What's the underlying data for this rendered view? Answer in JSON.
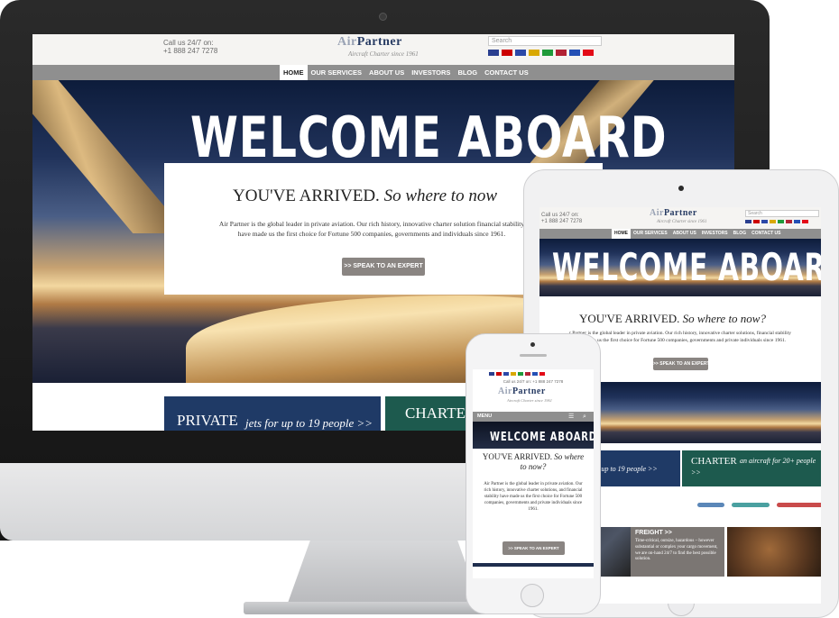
{
  "site": {
    "logo_air": "Air",
    "logo_partner": "Partner",
    "logo_tagline": "Aircraft Charter since 1961",
    "call_line1": "Call us 24/7 on:",
    "call_line2": "+1 888 247 7278",
    "call_inline": "Call us 24/7 on: +1 888 247 7278",
    "search_placeholder": "Search",
    "nav": [
      "HOME",
      "OUR SERVICES",
      "ABOUT US",
      "INVESTORS",
      "BLOG",
      "CONTACT US"
    ],
    "menu_label": "MENU",
    "menu_icon": "hamburger-icon",
    "search_icon": "search-icon",
    "flags": [
      {
        "name": "uk-flag",
        "color": "#2a3f8f"
      },
      {
        "name": "germany-flag",
        "color": "#cc0000"
      },
      {
        "name": "france-flag",
        "color": "#2b48a8"
      },
      {
        "name": "spain-flag",
        "color": "#d9a800"
      },
      {
        "name": "italy-flag",
        "color": "#1f9a3a"
      },
      {
        "name": "usa-flag",
        "color": "#b22234"
      },
      {
        "name": "russia-flag",
        "color": "#2450b5"
      },
      {
        "name": "turkey-flag",
        "color": "#e30a17"
      }
    ]
  },
  "hero": {
    "headline": "WELCOME ABOARD",
    "arrived_main": "YOU'VE ARRIVED.",
    "arrived_italic": "So where to now?",
    "desktop_arrived_italic": "So where to now",
    "body": "Air Partner is the global leader in private aviation. Our rich history, innovative charter solutions, and financial stability have made us the first choice for Fortune 500 companies, governments and private individuals since 1961.",
    "desktop_body": "Air Partner is the global leader in private aviation. Our rich history, innovative charter solution financial stability have made us the first choice for Fortune 500 companies, governments and individuals since 1961.",
    "tablet_body": "r Partner is the global leader in private aviation. Our rich history, innovative charter solutions, financial stability have made us the first choice for Fortune 500 companies, governments and private individuals since 1961.",
    "cta": ">> SPEAK TO AN EXPERT"
  },
  "promos": {
    "desktop_private_big": "PRIVATE",
    "desktop_private_small": "jets for up to 19 people  >>",
    "desktop_charter_big": "CHARTE",
    "tablet_private_small": "s for up to 19 people  >>",
    "tablet_charter_big": "CHARTER",
    "tablet_charter_small": "an aircraft for 20+ people  >>",
    "freight_title": "FREIGHT  >>",
    "freight_body": "Time-critical, outsize, hazardous – however substantial or complex your cargo movement, we are on-hand 24/7 to find the best possible solution."
  },
  "jets": [
    {
      "name": "jet-small",
      "color": "#5b87b8"
    },
    {
      "name": "jet-medium",
      "color": "#4aa0a0"
    },
    {
      "name": "jet-large",
      "color": "#c94b4b"
    }
  ]
}
